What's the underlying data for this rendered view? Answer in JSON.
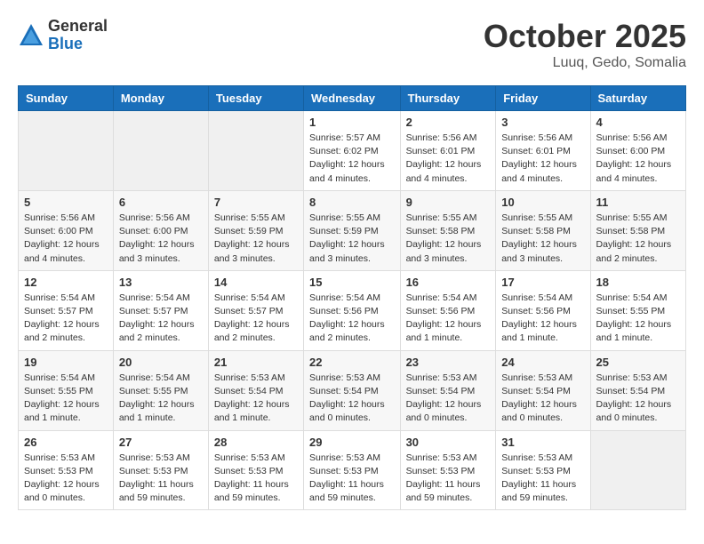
{
  "header": {
    "logo_general": "General",
    "logo_blue": "Blue",
    "month": "October 2025",
    "location": "Luuq, Gedo, Somalia"
  },
  "days_of_week": [
    "Sunday",
    "Monday",
    "Tuesday",
    "Wednesday",
    "Thursday",
    "Friday",
    "Saturday"
  ],
  "weeks": [
    [
      null,
      null,
      null,
      {
        "date": "1",
        "sunrise": "5:57 AM",
        "sunset": "6:02 PM",
        "daylight": "12 hours and 4 minutes."
      },
      {
        "date": "2",
        "sunrise": "5:56 AM",
        "sunset": "6:01 PM",
        "daylight": "12 hours and 4 minutes."
      },
      {
        "date": "3",
        "sunrise": "5:56 AM",
        "sunset": "6:01 PM",
        "daylight": "12 hours and 4 minutes."
      },
      {
        "date": "4",
        "sunrise": "5:56 AM",
        "sunset": "6:00 PM",
        "daylight": "12 hours and 4 minutes."
      }
    ],
    [
      {
        "date": "5",
        "sunrise": "5:56 AM",
        "sunset": "6:00 PM",
        "daylight": "12 hours and 4 minutes."
      },
      {
        "date": "6",
        "sunrise": "5:56 AM",
        "sunset": "6:00 PM",
        "daylight": "12 hours and 3 minutes."
      },
      {
        "date": "7",
        "sunrise": "5:55 AM",
        "sunset": "5:59 PM",
        "daylight": "12 hours and 3 minutes."
      },
      {
        "date": "8",
        "sunrise": "5:55 AM",
        "sunset": "5:59 PM",
        "daylight": "12 hours and 3 minutes."
      },
      {
        "date": "9",
        "sunrise": "5:55 AM",
        "sunset": "5:58 PM",
        "daylight": "12 hours and 3 minutes."
      },
      {
        "date": "10",
        "sunrise": "5:55 AM",
        "sunset": "5:58 PM",
        "daylight": "12 hours and 3 minutes."
      },
      {
        "date": "11",
        "sunrise": "5:55 AM",
        "sunset": "5:58 PM",
        "daylight": "12 hours and 2 minutes."
      }
    ],
    [
      {
        "date": "12",
        "sunrise": "5:54 AM",
        "sunset": "5:57 PM",
        "daylight": "12 hours and 2 minutes."
      },
      {
        "date": "13",
        "sunrise": "5:54 AM",
        "sunset": "5:57 PM",
        "daylight": "12 hours and 2 minutes."
      },
      {
        "date": "14",
        "sunrise": "5:54 AM",
        "sunset": "5:57 PM",
        "daylight": "12 hours and 2 minutes."
      },
      {
        "date": "15",
        "sunrise": "5:54 AM",
        "sunset": "5:56 PM",
        "daylight": "12 hours and 2 minutes."
      },
      {
        "date": "16",
        "sunrise": "5:54 AM",
        "sunset": "5:56 PM",
        "daylight": "12 hours and 1 minute."
      },
      {
        "date": "17",
        "sunrise": "5:54 AM",
        "sunset": "5:56 PM",
        "daylight": "12 hours and 1 minute."
      },
      {
        "date": "18",
        "sunrise": "5:54 AM",
        "sunset": "5:55 PM",
        "daylight": "12 hours and 1 minute."
      }
    ],
    [
      {
        "date": "19",
        "sunrise": "5:54 AM",
        "sunset": "5:55 PM",
        "daylight": "12 hours and 1 minute."
      },
      {
        "date": "20",
        "sunrise": "5:54 AM",
        "sunset": "5:55 PM",
        "daylight": "12 hours and 1 minute."
      },
      {
        "date": "21",
        "sunrise": "5:53 AM",
        "sunset": "5:54 PM",
        "daylight": "12 hours and 1 minute."
      },
      {
        "date": "22",
        "sunrise": "5:53 AM",
        "sunset": "5:54 PM",
        "daylight": "12 hours and 0 minutes."
      },
      {
        "date": "23",
        "sunrise": "5:53 AM",
        "sunset": "5:54 PM",
        "daylight": "12 hours and 0 minutes."
      },
      {
        "date": "24",
        "sunrise": "5:53 AM",
        "sunset": "5:54 PM",
        "daylight": "12 hours and 0 minutes."
      },
      {
        "date": "25",
        "sunrise": "5:53 AM",
        "sunset": "5:54 PM",
        "daylight": "12 hours and 0 minutes."
      }
    ],
    [
      {
        "date": "26",
        "sunrise": "5:53 AM",
        "sunset": "5:53 PM",
        "daylight": "12 hours and 0 minutes."
      },
      {
        "date": "27",
        "sunrise": "5:53 AM",
        "sunset": "5:53 PM",
        "daylight": "11 hours and 59 minutes."
      },
      {
        "date": "28",
        "sunrise": "5:53 AM",
        "sunset": "5:53 PM",
        "daylight": "11 hours and 59 minutes."
      },
      {
        "date": "29",
        "sunrise": "5:53 AM",
        "sunset": "5:53 PM",
        "daylight": "11 hours and 59 minutes."
      },
      {
        "date": "30",
        "sunrise": "5:53 AM",
        "sunset": "5:53 PM",
        "daylight": "11 hours and 59 minutes."
      },
      {
        "date": "31",
        "sunrise": "5:53 AM",
        "sunset": "5:53 PM",
        "daylight": "11 hours and 59 minutes."
      },
      null
    ]
  ]
}
